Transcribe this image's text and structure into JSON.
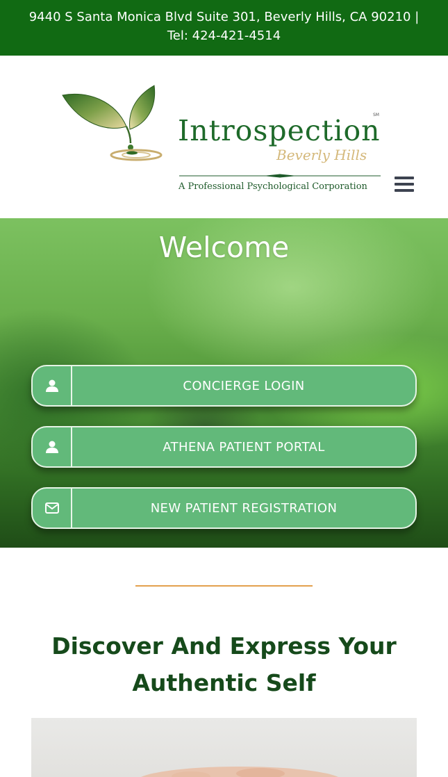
{
  "topbar": {
    "contact_text": "9440 S Santa Monica Blvd Suite 301, Beverly Hills, CA 90210 | Tel: 424-421-4514"
  },
  "logo": {
    "title": "Introspection",
    "trademark": "SM",
    "subtitle": "Beverly Hills",
    "tagline": "A Professional Psychological Corporation"
  },
  "header": {
    "menu_icon": "hamburger-menu-icon"
  },
  "hero": {
    "title": "Welcome",
    "buttons": [
      {
        "label": "CONCIERGE LOGIN",
        "icon": "user-icon"
      },
      {
        "label": "ATHENA PATIENT PORTAL",
        "icon": "user-icon"
      },
      {
        "label": "NEW PATIENT REGISTRATION",
        "icon": "envelope-icon"
      }
    ]
  },
  "section": {
    "title": "Discover And Express Your Authentic Self"
  },
  "colors": {
    "topbar_bg": "#116a13",
    "button_bg": "#62b97a",
    "divider": "#e3a04d",
    "heading": "#164a1b"
  }
}
